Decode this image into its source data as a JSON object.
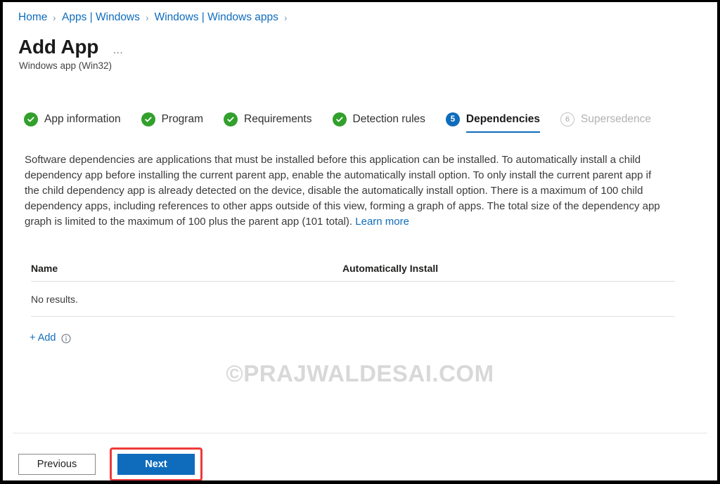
{
  "breadcrumb": {
    "items": [
      {
        "label": "Home"
      },
      {
        "label": "Apps | Windows"
      },
      {
        "label": "Windows | Windows apps"
      }
    ],
    "separator": "›"
  },
  "header": {
    "title": "Add App",
    "overflow_menu": "…",
    "subtitle": "Windows app (Win32)"
  },
  "wizard": {
    "steps": [
      {
        "number": "1",
        "label": "App information",
        "state": "done"
      },
      {
        "number": "2",
        "label": "Program",
        "state": "done"
      },
      {
        "number": "3",
        "label": "Requirements",
        "state": "done"
      },
      {
        "number": "4",
        "label": "Detection rules",
        "state": "done"
      },
      {
        "number": "5",
        "label": "Dependencies",
        "state": "active"
      },
      {
        "number": "6",
        "label": "Supersedence",
        "state": "disabled"
      }
    ]
  },
  "main": {
    "description": "Software dependencies are applications that must be installed before this application can be installed. To automatically install a child dependency app before installing the current parent app, enable the automatically install option. To only install the current parent app if the child dependency app is already detected on the device, disable the automatically install option. There is a maximum of 100 child dependency apps, including references to other apps outside of this view, forming a graph of apps. The total size of the dependency app graph is limited to the maximum of 100 plus the parent app (101 total). ",
    "learn_more": "Learn more",
    "table": {
      "columns": [
        "Name",
        "Automatically Install"
      ],
      "empty_message": "No results."
    },
    "add_link": {
      "label": "+ Add",
      "info_icon": "info-icon"
    }
  },
  "watermark": "©PRAJWALDESAI.COM",
  "footer": {
    "previous_label": "Previous",
    "next_label": "Next"
  },
  "colors": {
    "link": "#0f6cbd",
    "accent": "#0f6cbd",
    "success": "#32a02c",
    "highlight": "#ef3a3a",
    "disabled": "#b2b2b2"
  }
}
